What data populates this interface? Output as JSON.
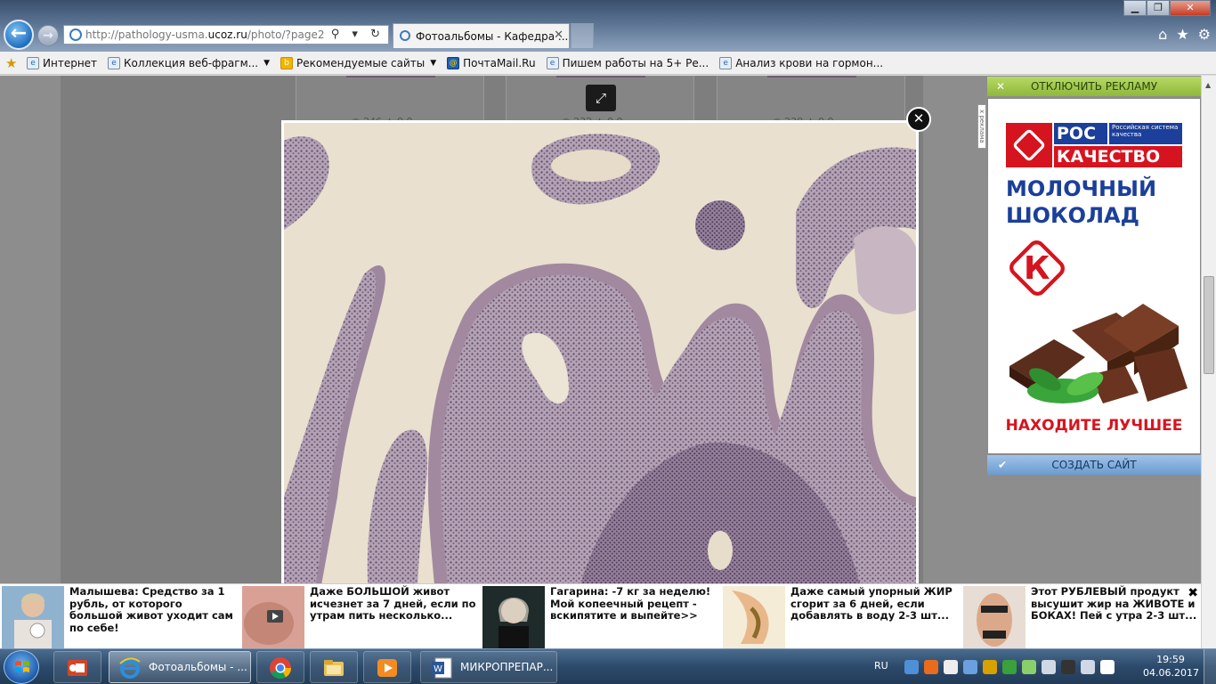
{
  "browser": {
    "url_prefix": "http://pathology-usma.",
    "url_domain": "ucoz.ru",
    "url_suffix": "/photo/?page2",
    "addr_tools": "⚲ ▾ ↻",
    "tab_title": "Фотоальбомы - Кафедра ...",
    "tab_close": "✕",
    "window_controls": {
      "minimize": "▁",
      "maximize": "❐",
      "close": "✕"
    },
    "right_icons": {
      "home": "⌂",
      "favorites": "★",
      "tools": "⚙"
    }
  },
  "favorites": [
    {
      "label": "Интернет",
      "icon": "ie-icon",
      "dropdown": false
    },
    {
      "label": "Коллекция веб-фрагм...",
      "icon": "ie-icon",
      "dropdown": true
    },
    {
      "label": "Рекомендуемые сайты",
      "icon": "bing-icon",
      "dropdown": true
    },
    {
      "label": "ПочтаMail.Ru",
      "icon": "mail-ru-icon",
      "dropdown": false
    },
    {
      "label": "Пишем работы на 5+  Ре...",
      "icon": "ie-icon",
      "dropdown": false
    },
    {
      "label": "Анализ крови на гормон...",
      "icon": "ie-icon",
      "dropdown": false
    }
  ],
  "gallery": {
    "cards": [
      {
        "views": "246",
        "rating": "0.0"
      },
      {
        "views": "232",
        "rating": "0.0"
      },
      {
        "views": "238",
        "rating": "0.0"
      }
    ],
    "expand_icon": "⤢",
    "close_icon": "✕"
  },
  "ad": {
    "disable_label": "ОТКЛЮЧИТЬ РЕКЛАМУ",
    "disable_x": "✕",
    "badge": "x реклама",
    "brand_line1": "РОС",
    "brand_small": "Российская система качества",
    "brand_line2": "КАЧЕСТВО",
    "product_line1": "МОЛОЧНЫЙ",
    "product_line2": "ШОКОЛАД",
    "k_letter": "К",
    "slogan": "НАХОДИТЕ ЛУЧШЕЕ",
    "create_label": "СОЗДАТЬ САЙТ",
    "create_check": "✔"
  },
  "news": [
    {
      "text": "Малышева: Средство за 1 рубль, от которого большой живот уходит сам по себе!"
    },
    {
      "text": "Даже БОЛЬШОЙ живот исчезнет за 7 дней, если по утрам пить несколько..."
    },
    {
      "text": "Гагарина: -7 кг за неделю! Мой копеечный рецепт - вскипятите и выпейте>>"
    },
    {
      "text": "Даже самый упорный ЖИР сгорит за 6 дней, если добавлять в воду 2-3 шт..."
    },
    {
      "text": "Этот РУБЛЕВЫЙ продукт высушит жир на ЖИВОТЕ и БОКАХ! Пей с утра 2-3 шт..."
    }
  ],
  "news_close": "✖",
  "taskbar": {
    "items": [
      {
        "label": "",
        "icon": "presentation-icon"
      },
      {
        "label": "Фотоальбомы - ...",
        "icon": "ie-icon",
        "active": true
      },
      {
        "label": "",
        "icon": "chrome-icon"
      },
      {
        "label": "",
        "icon": "folder-icon"
      },
      {
        "label": "",
        "icon": "media-player-icon"
      },
      {
        "label": "МИКРОПРЕПАР...",
        "icon": "word-icon"
      }
    ],
    "lang": "RU",
    "time": "19:59",
    "date": "04.06.2017"
  },
  "colors": {
    "accent_green": "#8fb83a",
    "accent_blue": "#6b9cd0",
    "brand_red": "#d6141f",
    "brand_blue": "#1b3f9a"
  }
}
